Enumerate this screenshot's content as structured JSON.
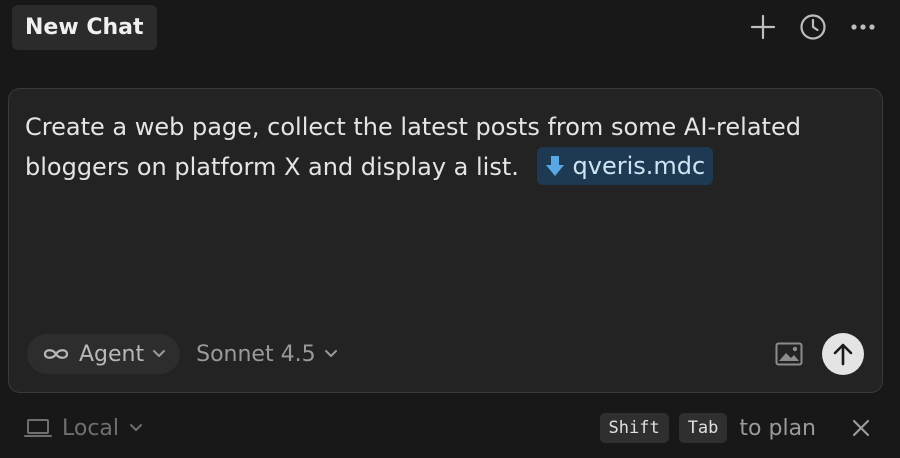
{
  "header": {
    "tab_title": "New Chat",
    "actions": [
      "plus-icon",
      "history-icon",
      "more-icon"
    ]
  },
  "composer": {
    "prompt_text": "Create a web page, collect the latest posts from some AI-related bloggers on platform X and display a list.",
    "mention": {
      "icon": "download-arrow-icon",
      "label": "qveris.mdc",
      "accent": "#1e3a52",
      "icon_color": "#5aa7e6"
    },
    "mode": {
      "icon": "infinity-icon",
      "label": "Agent"
    },
    "model": {
      "label": "Sonnet 4.5"
    }
  },
  "footer": {
    "environment": {
      "icon": "laptop-icon",
      "label": "Local"
    },
    "shortcut_keys": [
      "Shift",
      "Tab"
    ],
    "shortcut_hint": "to plan"
  },
  "colors": {
    "background": "#181818",
    "panel": "#232323",
    "send_button": "#e4e4e4"
  }
}
